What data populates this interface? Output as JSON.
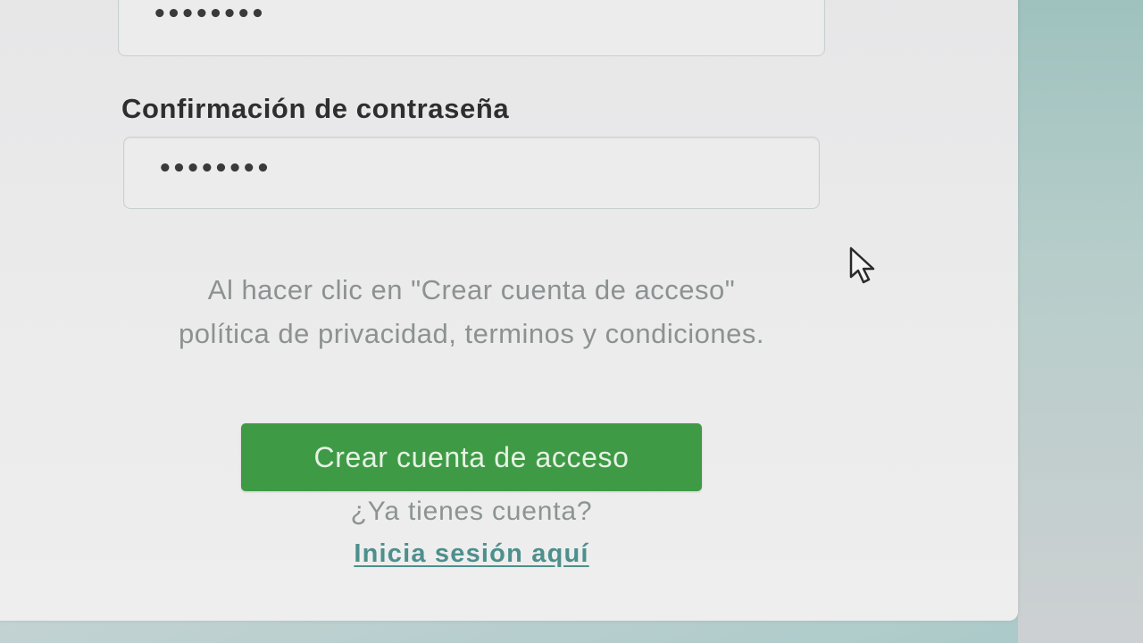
{
  "form": {
    "password_value": "••••••••",
    "confirm_label": "Confirmación de contraseña",
    "confirm_value": "••••••••",
    "terms_text": "Al hacer clic en \"Crear cuenta de acceso\" política de privacidad, terminos y condiciones.",
    "create_button_label": "Crear cuenta de acceso",
    "have_account_text": "¿Ya tienes cuenta?",
    "login_link_label": "Inicia sesión aquí"
  },
  "colors": {
    "button": "#3f9a46",
    "link": "#4d8f8c",
    "muted_text": "#8c9191"
  },
  "icons": {
    "cursor": "mouse-pointer-icon"
  }
}
